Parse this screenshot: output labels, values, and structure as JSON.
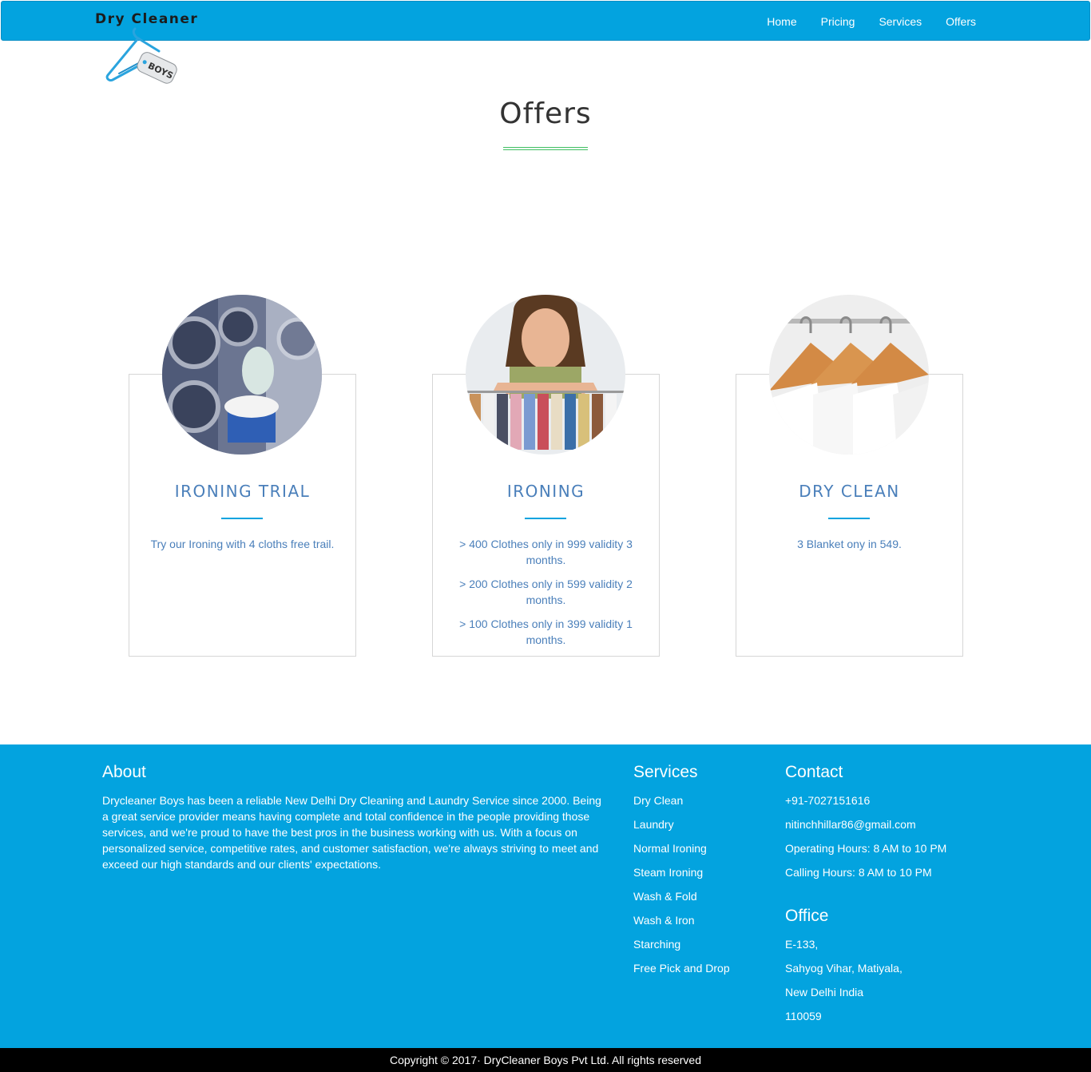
{
  "brand": {
    "name": "Dry Cleaner",
    "tag": "BOYS"
  },
  "nav": [
    {
      "label": "Home"
    },
    {
      "label": "Pricing"
    },
    {
      "label": "Services"
    },
    {
      "label": "Offers"
    }
  ],
  "page": {
    "title": "Offers"
  },
  "offers": [
    {
      "title": "IRONING TRIAL",
      "lines": [
        "Try our Ironing with 4 cloths free trail."
      ]
    },
    {
      "title": "IRONING",
      "lines": [
        "> 400 Clothes only in 999 validity 3 months.",
        "> 200 Clothes only in 599 validity 2 months.",
        "> 100 Clothes only in 399 validity 1 months."
      ]
    },
    {
      "title": "DRY CLEAN",
      "lines": [
        "3 Blanket ony in 549."
      ]
    }
  ],
  "footer": {
    "about": {
      "heading": "About",
      "text": "Drycleaner Boys has been a reliable New Delhi Dry Cleaning and Laundry Service since 2000. Being a great service provider means having complete and total confidence in the people providing those services, and we're proud to have the best pros in the business working with us. With a focus on personalized service, competitive rates, and customer satisfaction, we're always striving to meet and exceed our high standards and our clients' expectations."
    },
    "services": {
      "heading": "Services",
      "items": [
        "Dry Clean",
        "Laundry",
        "Normal Ironing",
        "Steam Ironing",
        "Wash & Fold",
        "Wash & Iron",
        "Starching",
        "Free Pick and Drop"
      ]
    },
    "contact": {
      "heading": "Contact",
      "items": [
        "+91-7027151616",
        "nitinchhillar86@gmail.com",
        "Operating Hours: 8 AM to 10 PM",
        "Calling Hours: 8 AM to 10 PM"
      ]
    },
    "office": {
      "heading": "Office",
      "items": [
        "E-133,",
        "Sahyog Vihar, Matiyala,",
        "New Delhi India",
        "110059"
      ]
    },
    "copyright": "Copyright © 2017· DryCleaner Boys Pvt Ltd. All rights reserved"
  },
  "colors": {
    "primary": "#03a3df",
    "title_accent": "#4a7fba",
    "rule_green": "#3fbf62",
    "copyright_bg": "#000000"
  }
}
